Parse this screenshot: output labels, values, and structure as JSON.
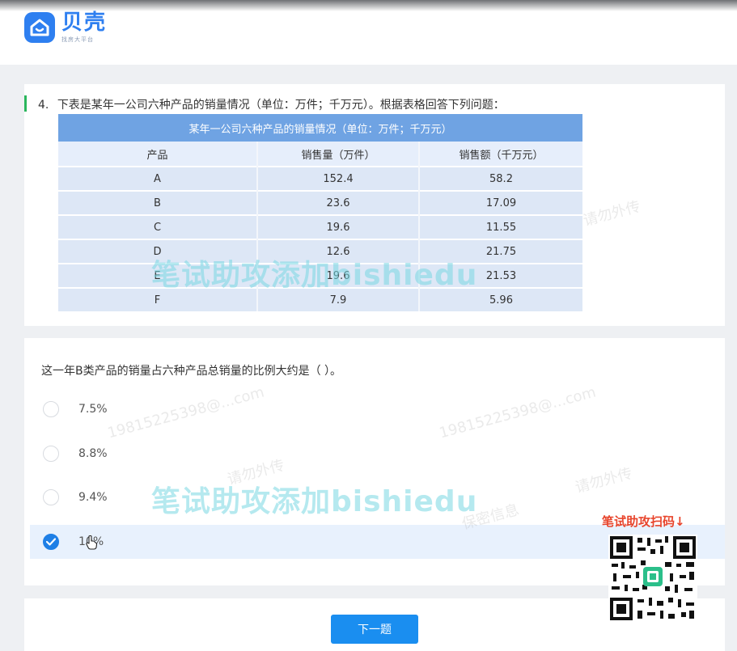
{
  "header": {
    "logo_name": "贝壳",
    "logo_sub": "找房大平台"
  },
  "question": {
    "number": "4.",
    "stem": "下表是某年一公司六种产品的销量情况（单位：万件；千万元）。根据表格回答下列问题：",
    "table": {
      "title": "某年一公司六种产品的销量情况（单位：万件；千万元）",
      "columns": [
        "产品",
        "销售量（万件）",
        "销售额（千万元）"
      ],
      "rows": [
        [
          "A",
          "152.4",
          "58.2"
        ],
        [
          "B",
          "23.6",
          "17.09"
        ],
        [
          "C",
          "19.6",
          "11.55"
        ],
        [
          "D",
          "12.6",
          "21.75"
        ],
        [
          "E",
          "19.6",
          "21.53"
        ],
        [
          "F",
          "7.9",
          "5.96"
        ]
      ]
    }
  },
  "sub_question": {
    "text": "这一年B类产品的销量占六种产品总销量的比例大约是（ ）。",
    "options": [
      {
        "label": "7.5%",
        "selected": false
      },
      {
        "label": "8.8%",
        "selected": false
      },
      {
        "label": "9.4%",
        "selected": false
      },
      {
        "label": "10%",
        "selected": true
      }
    ]
  },
  "footer": {
    "next_label": "下一题"
  },
  "overlay": {
    "watermark": "笔试助攻添加bishiedu",
    "qr_label": "笔试助攻扫码↓",
    "faint_marks": [
      "19815225398@...com",
      "请勿外传",
      "保密信息"
    ]
  },
  "colors": {
    "accent_blue": "#1a8ef0",
    "table_header": "#6fa3e3",
    "green_marker": "#2ab65c",
    "qr_label": "#e8452c"
  }
}
